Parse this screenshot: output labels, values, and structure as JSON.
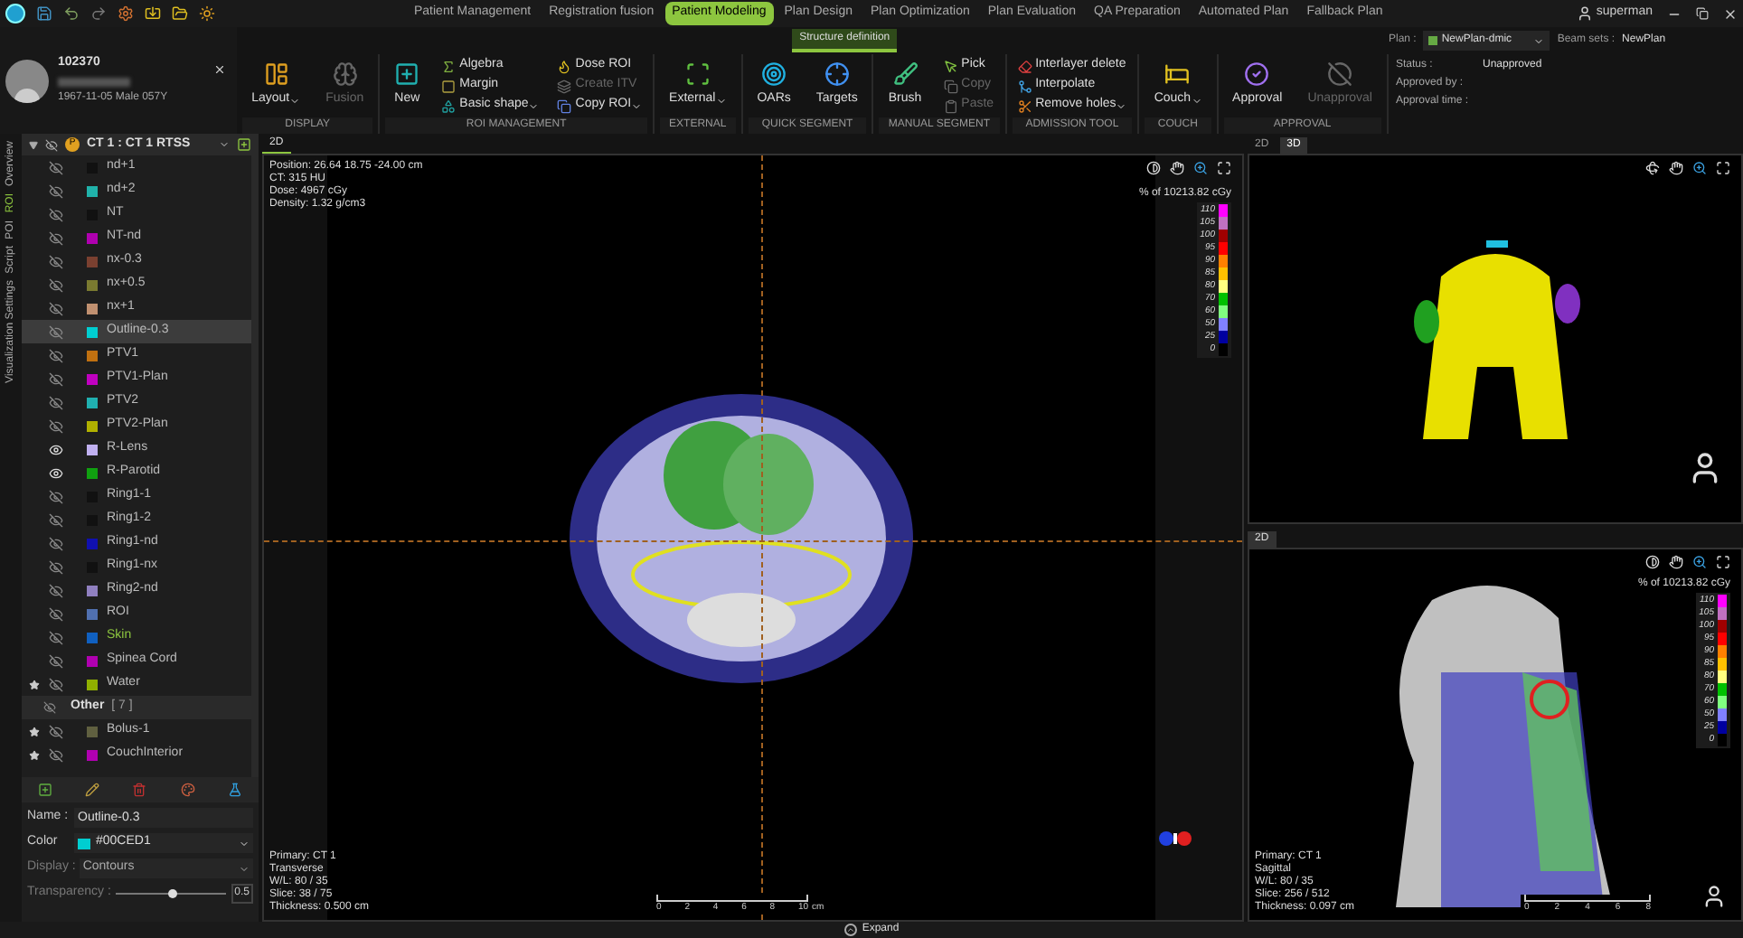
{
  "nav_tabs": [
    {
      "label": "Patient Management",
      "selected": false
    },
    {
      "label": "Registration fusion",
      "selected": false
    },
    {
      "label": "Patient Modeling",
      "selected": true
    },
    {
      "label": "Plan Design",
      "selected": false
    },
    {
      "label": "Plan Optimization",
      "selected": false
    },
    {
      "label": "Plan Evaluation",
      "selected": false
    },
    {
      "label": "QA Preparation",
      "selected": false
    },
    {
      "label": "Automated Plan",
      "selected": false
    },
    {
      "label": "Fallback Plan",
      "selected": false
    }
  ],
  "user": {
    "name": "superman"
  },
  "sub_tabs": [
    {
      "label": "Structure definition",
      "selected": true
    }
  ],
  "patient": {
    "id": "102370",
    "details": "1967-11-05 Male 057Y"
  },
  "plan": {
    "plan_label": "Plan :",
    "plan_value": "NewPlan-dmic",
    "beam_label": "Beam sets :",
    "beam_value": "NewPlan",
    "fields": [
      {
        "label": "Status :",
        "value": "Unapproved"
      },
      {
        "label": "Approved by :"
      },
      {
        "label": "Approval time :"
      }
    ]
  },
  "ribbon": [
    {
      "label": "DISPLAY",
      "columns": [
        {
          "kind": "large",
          "items": [
            {
              "label": "Layout",
              "disabled": false,
              "menu": true
            }
          ]
        },
        {
          "kind": "large",
          "items": [
            {
              "label": "Fusion",
              "disabled": true,
              "menu": false
            }
          ]
        }
      ]
    },
    {
      "label": "ROI MANAGEMENT",
      "columns": [
        {
          "kind": "large",
          "items": [
            {
              "label": "New",
              "disabled": false,
              "menu": false
            }
          ]
        },
        {
          "kind": "stack",
          "items": [
            {
              "label": "Algebra",
              "disabled": false,
              "menu": false
            },
            {
              "label": "Margin",
              "disabled": false,
              "menu": false
            },
            {
              "label": "Basic shape",
              "disabled": false,
              "menu": true
            }
          ]
        },
        {
          "kind": "stack",
          "items": [
            {
              "label": "Dose ROI",
              "disabled": false,
              "menu": false
            },
            {
              "label": "Create ITV",
              "disabled": true,
              "menu": false
            },
            {
              "label": "Copy ROI",
              "disabled": false,
              "menu": true
            }
          ]
        }
      ]
    },
    {
      "label": "EXTERNAL",
      "columns": [
        {
          "kind": "large",
          "items": [
            {
              "label": "External",
              "disabled": false,
              "menu": true
            }
          ]
        }
      ]
    },
    {
      "label": "QUICK SEGMENT",
      "columns": [
        {
          "kind": "large",
          "items": [
            {
              "label": "OARs",
              "disabled": false,
              "menu": false
            }
          ]
        },
        {
          "kind": "large",
          "items": [
            {
              "label": "Targets",
              "disabled": false,
              "menu": false
            }
          ]
        }
      ]
    },
    {
      "label": "MANUAL SEGMENT",
      "columns": [
        {
          "kind": "large",
          "items": [
            {
              "label": "Brush",
              "disabled": false,
              "menu": false
            }
          ]
        },
        {
          "kind": "stack",
          "items": [
            {
              "label": "Pick",
              "disabled": false,
              "menu": false
            },
            {
              "label": "Copy",
              "disabled": true,
              "menu": false
            },
            {
              "label": "Paste",
              "disabled": true,
              "menu": false
            }
          ]
        }
      ]
    },
    {
      "label": "ADMISSION TOOL",
      "columns": [
        {
          "kind": "stack",
          "items": [
            {
              "label": "Interlayer delete",
              "disabled": false,
              "menu": false
            },
            {
              "label": "Interpolate",
              "disabled": false,
              "menu": false
            },
            {
              "label": "Remove holes",
              "disabled": false,
              "menu": true
            }
          ]
        }
      ]
    },
    {
      "label": "COUCH",
      "columns": [
        {
          "kind": "large",
          "items": [
            {
              "label": "Couch",
              "disabled": false,
              "menu": true
            }
          ]
        }
      ]
    },
    {
      "label": "APPROVAL",
      "columns": [
        {
          "kind": "large",
          "items": [
            {
              "label": "Approval",
              "disabled": false,
              "menu": false
            }
          ]
        },
        {
          "kind": "large",
          "items": [
            {
              "label": "Unapproval",
              "disabled": true,
              "menu": false
            }
          ]
        }
      ]
    }
  ],
  "side_tabs": [
    {
      "label": "Overview",
      "selected": false
    },
    {
      "label": "ROI",
      "selected": true
    },
    {
      "label": "POI",
      "selected": false
    },
    {
      "label": "Script",
      "selected": false
    },
    {
      "label": "Visualization Settings",
      "selected": false
    }
  ],
  "roi": {
    "dataset": "CT 1 : CT 1 RTSS",
    "badge": "P",
    "items": [
      {
        "name": "nd+1",
        "color": "#111111",
        "visible": false,
        "starred": false,
        "selected": false,
        "highlighted": false
      },
      {
        "name": "nd+2",
        "color": "#20b2aa",
        "visible": false,
        "starred": false,
        "selected": false,
        "highlighted": false
      },
      {
        "name": "NT",
        "color": "#111111",
        "visible": false,
        "starred": false,
        "selected": false,
        "highlighted": false
      },
      {
        "name": "NT-nd",
        "color": "#b000b0",
        "visible": false,
        "starred": false,
        "selected": false,
        "highlighted": false
      },
      {
        "name": "nx-0.3",
        "color": "#7a4030",
        "visible": false,
        "starred": false,
        "selected": false,
        "highlighted": false
      },
      {
        "name": "nx+0.5",
        "color": "#7a7a30",
        "visible": false,
        "starred": false,
        "selected": false,
        "highlighted": false
      },
      {
        "name": "nx+1",
        "color": "#c09070",
        "visible": false,
        "starred": false,
        "selected": false,
        "highlighted": false
      },
      {
        "name": "Outline-0.3",
        "color": "#00ced1",
        "visible": false,
        "starred": false,
        "selected": true,
        "highlighted": false
      },
      {
        "name": "PTV1",
        "color": "#c07010",
        "visible": false,
        "starred": false,
        "selected": false,
        "highlighted": false
      },
      {
        "name": "PTV1-Plan",
        "color": "#c000c0",
        "visible": false,
        "starred": false,
        "selected": false,
        "highlighted": false
      },
      {
        "name": "PTV2",
        "color": "#20b0b0",
        "visible": false,
        "starred": false,
        "selected": false,
        "highlighted": false
      },
      {
        "name": "PTV2-Plan",
        "color": "#b0b000",
        "visible": false,
        "starred": false,
        "selected": false,
        "highlighted": false
      },
      {
        "name": "R-Lens",
        "color": "#c0b0f0",
        "visible": true,
        "starred": false,
        "selected": false,
        "highlighted": false
      },
      {
        "name": "R-Parotid",
        "color": "#10a010",
        "visible": true,
        "starred": false,
        "selected": false,
        "highlighted": false
      },
      {
        "name": "Ring1-1",
        "color": "#111111",
        "visible": false,
        "starred": false,
        "selected": false,
        "highlighted": false
      },
      {
        "name": "Ring1-2",
        "color": "#111111",
        "visible": false,
        "starred": false,
        "selected": false,
        "highlighted": false
      },
      {
        "name": "Ring1-nd",
        "color": "#1010b0",
        "visible": false,
        "starred": false,
        "selected": false,
        "highlighted": false
      },
      {
        "name": "Ring1-nx",
        "color": "#111111",
        "visible": false,
        "starred": false,
        "selected": false,
        "highlighted": false
      },
      {
        "name": "Ring2-nd",
        "color": "#9080c0",
        "visible": false,
        "starred": false,
        "selected": false,
        "highlighted": false
      },
      {
        "name": "ROI",
        "color": "#5070b0",
        "visible": false,
        "starred": false,
        "selected": false,
        "highlighted": false
      },
      {
        "name": "Skin",
        "color": "#1060c0",
        "visible": false,
        "starred": false,
        "selected": false,
        "highlighted": true
      },
      {
        "name": "Spinea Cord",
        "color": "#b000b0",
        "visible": false,
        "starred": false,
        "selected": false,
        "highlighted": false
      },
      {
        "name": "Water",
        "color": "#90b000",
        "visible": false,
        "starred": true,
        "selected": false,
        "highlighted": false
      }
    ],
    "other_label": "Other",
    "other_count": "[ 7 ]",
    "other_items": [
      {
        "name": "Bolus-1",
        "color": "#606040",
        "visible": false,
        "starred": true,
        "selected": false,
        "highlighted": false
      },
      {
        "name": "CouchInterior",
        "color": "#b000b0",
        "visible": false,
        "starred": true,
        "selected": false,
        "highlighted": false
      }
    ]
  },
  "properties": {
    "name_label": "Name :",
    "name_value": "Outline-0.3",
    "color_label": "Color",
    "color_value": "#00CED1",
    "color": "#00ced1",
    "display_label": "Display :",
    "display_value": "Contours",
    "transparency_label": "Transparency :",
    "transparency": {
      "level": 0.5,
      "reading": "0.5"
    }
  },
  "transverse_view": {
    "tab": "2D",
    "info": [
      "Position: 26.64 18.75 -24.00 cm",
      "CT: 315 HU",
      "Dose: 4967 cGy",
      "Density: 1.32 g/cm3"
    ],
    "footer": [
      "Primary: CT 1",
      "Transverse",
      "W/L: 80 / 35",
      "Slice: 38 / 75",
      "Thickness: 0.500 cm"
    ],
    "scale": [
      "0",
      "2",
      "4",
      "6",
      "8",
      "10"
    ],
    "scale_unit": "cm",
    "dose_title": "% of 10213.82 cGy",
    "colorbar": [
      {
        "label": "110",
        "color": "#ff00ff"
      },
      {
        "label": "105",
        "color": "#c070c0"
      },
      {
        "label": "100",
        "color": "#a00000"
      },
      {
        "label": "95",
        "color": "#ff0000"
      },
      {
        "label": "90",
        "color": "#ff8000"
      },
      {
        "label": "85",
        "color": "#ffc000"
      },
      {
        "label": "80",
        "color": "#ffff80"
      },
      {
        "label": "70",
        "color": "#00c000"
      },
      {
        "label": "60",
        "color": "#80ff80"
      },
      {
        "label": "50",
        "color": "#8080ff"
      },
      {
        "label": "25",
        "color": "#0000a0"
      },
      {
        "label": "0",
        "color": "#000000"
      }
    ]
  },
  "view_3d": {
    "tabs": [
      {
        "label": "2D",
        "selected": false
      },
      {
        "label": "3D",
        "selected": true
      }
    ]
  },
  "sagittal_view": {
    "tab": "2D",
    "footer": [
      "Primary: CT 1",
      "Sagittal",
      "W/L: 80 / 35",
      "Slice: 256 / 512",
      "Thickness: 0.097 cm"
    ],
    "scale": [
      "0",
      "2",
      "4",
      "6",
      "8"
    ],
    "dose_title": "% of 10213.82 cGy",
    "colorbar": [
      {
        "label": "110",
        "color": "#ff00ff"
      },
      {
        "label": "105",
        "color": "#c070c0"
      },
      {
        "label": "100",
        "color": "#a00000"
      },
      {
        "label": "95",
        "color": "#ff0000"
      },
      {
        "label": "90",
        "color": "#ff8000"
      },
      {
        "label": "85",
        "color": "#ffc000"
      },
      {
        "label": "80",
        "color": "#ffff80"
      },
      {
        "label": "70",
        "color": "#00c000"
      },
      {
        "label": "60",
        "color": "#80ff80"
      },
      {
        "label": "50",
        "color": "#8080ff"
      },
      {
        "label": "25",
        "color": "#0000a0"
      },
      {
        "label": "0",
        "color": "#000000"
      }
    ]
  },
  "expand": {
    "label": "Expand"
  }
}
